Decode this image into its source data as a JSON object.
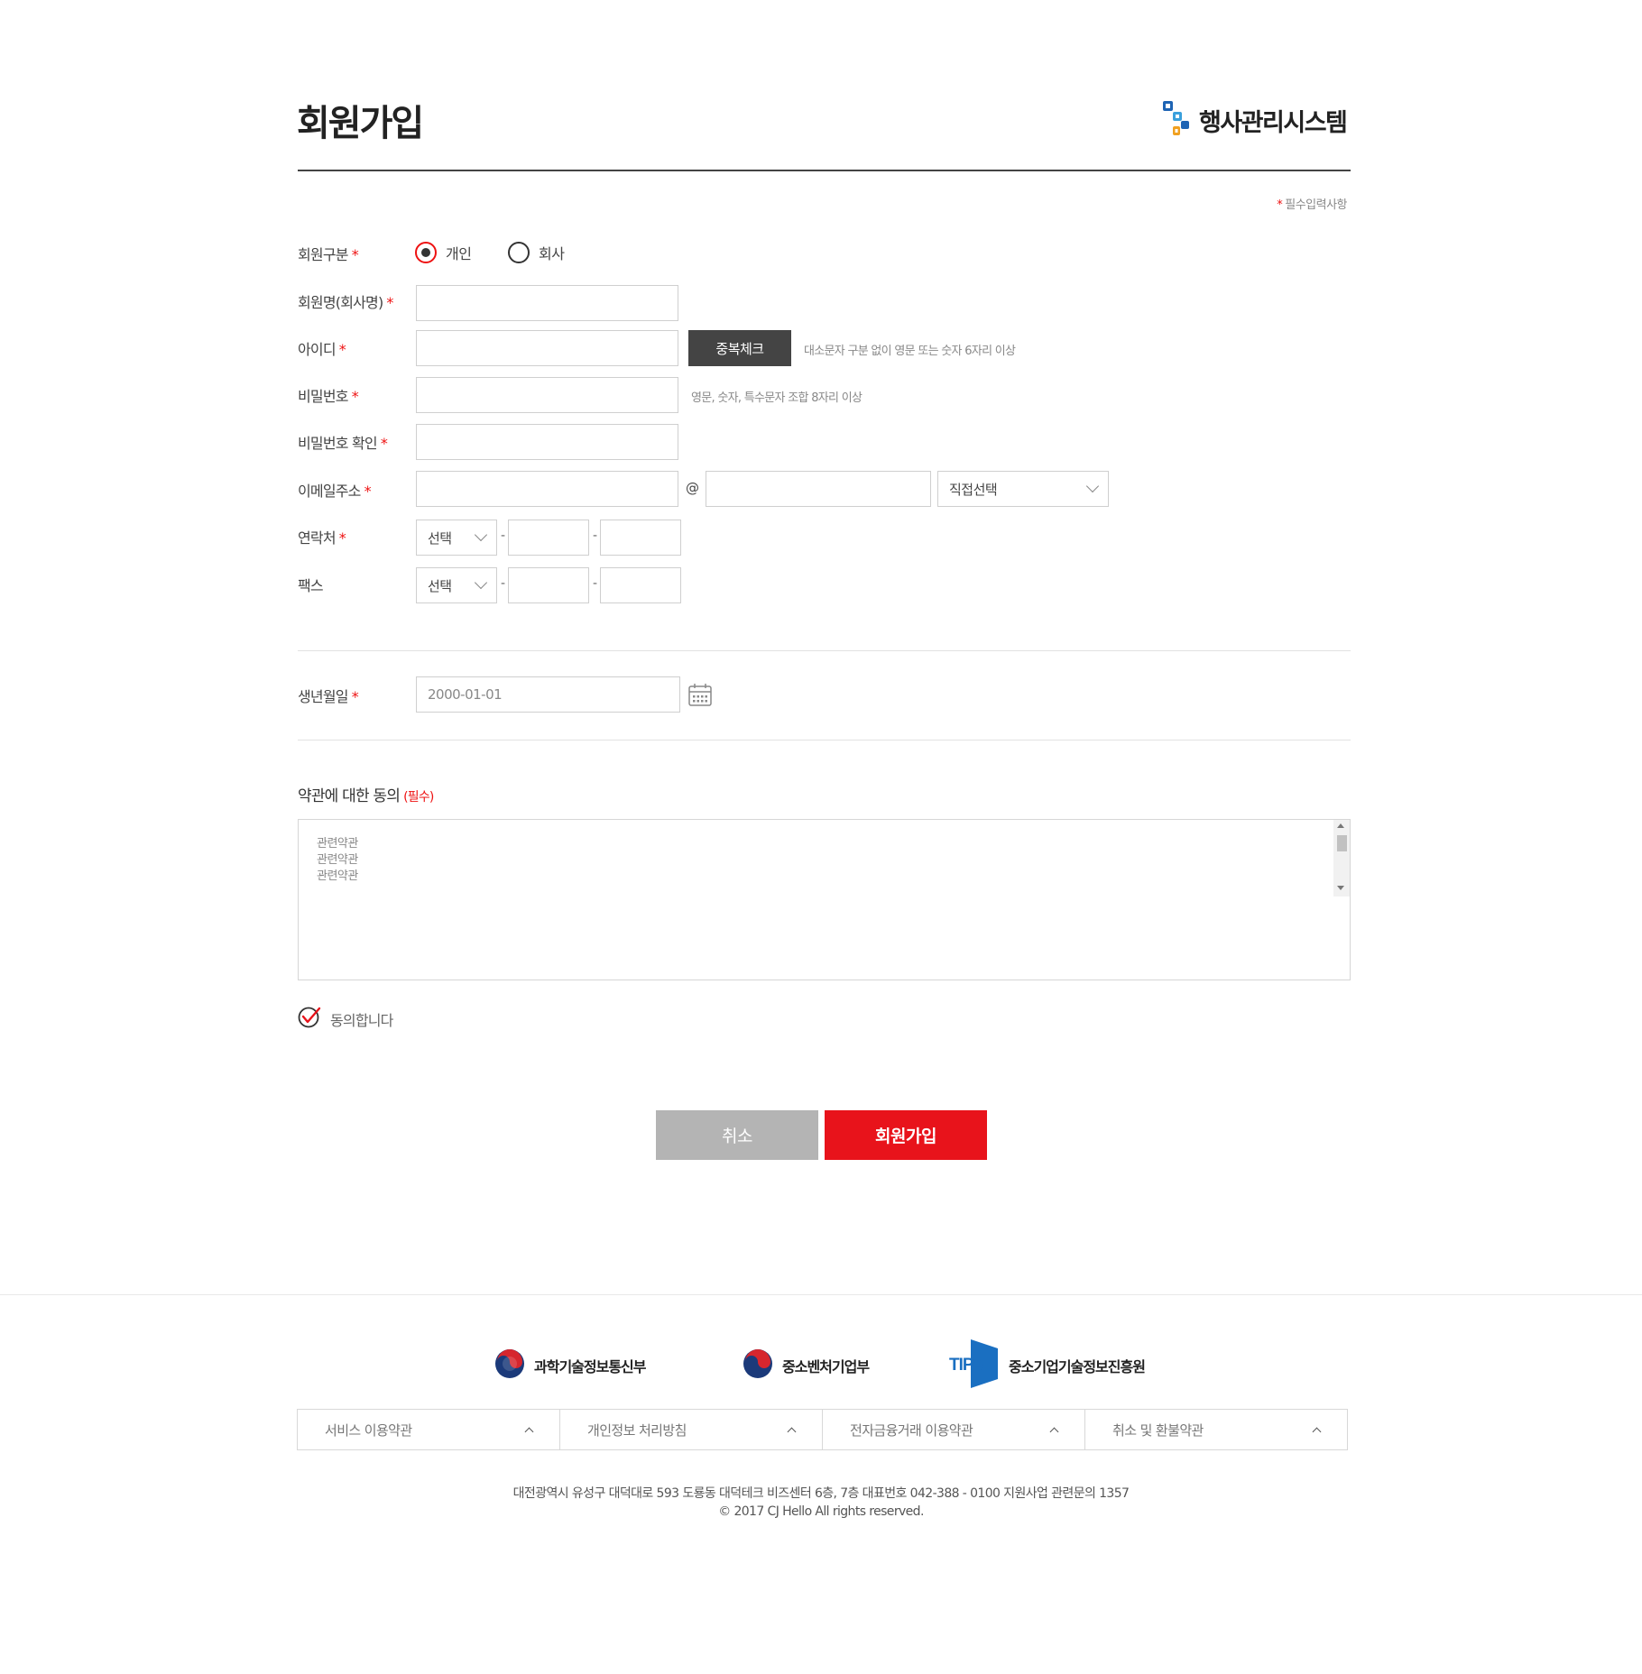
{
  "header": {
    "title": "회원가입",
    "logo_text": "행사관리시스템",
    "required_note": "필수입력사항",
    "required_star": "*"
  },
  "form": {
    "member_type": {
      "label": "회원구분",
      "options": [
        "개인",
        "회사"
      ],
      "selected": "개인"
    },
    "name": {
      "label": "회원명(회사명)",
      "value": ""
    },
    "id": {
      "label": "아이디",
      "value": "",
      "dup_button": "중복체크",
      "hint": "대소문자 구분 없이 영문 또는 숫자 6자리 이상"
    },
    "password": {
      "label": "비밀번호",
      "value": "",
      "hint": "영문, 숫자, 특수문자 조합 8자리 이상"
    },
    "password_confirm": {
      "label": "비밀번호 확인",
      "value": ""
    },
    "email": {
      "label": "이메일주소",
      "at": "@",
      "domain_select": "직접선택"
    },
    "phone": {
      "label": "연락처",
      "select": "선택",
      "separator": "-"
    },
    "fax": {
      "label": "팩스",
      "select": "선택",
      "separator": "-"
    },
    "birthday": {
      "label": "생년월일",
      "value": "2000-01-01"
    }
  },
  "terms": {
    "title": "약관에 대한 동의",
    "required_tag": "(필수)",
    "lines": [
      "관련약관",
      "관련약관",
      "관련약관"
    ],
    "agree_label": "동의합니다",
    "agreed": true
  },
  "actions": {
    "cancel": "취소",
    "submit": "회원가입"
  },
  "footer": {
    "partners": [
      "과학기술정보통신부",
      "중소벤처기업부",
      "중소기업기술정보진흥원"
    ],
    "tipa_logo_text": "TIPA",
    "policies": [
      "서비스 이용약관",
      "개인정보 처리방침",
      "전자금융거래 이용약관",
      "취소 및 환불약관"
    ],
    "address": "대전광역시 유성구 대덕대로 593 도룡동  대덕테크 비즈센터 6층, 7층  대표번호 042-388 - 0100  지원사업 관련문의 1357",
    "copyright": "© 2017 CJ Hello All rights reserved."
  },
  "colors": {
    "accent_red": "#e8131b",
    "dark_button": "#444444",
    "cancel_gray": "#b4b4b4",
    "logo_blue": "#1e64b4"
  }
}
